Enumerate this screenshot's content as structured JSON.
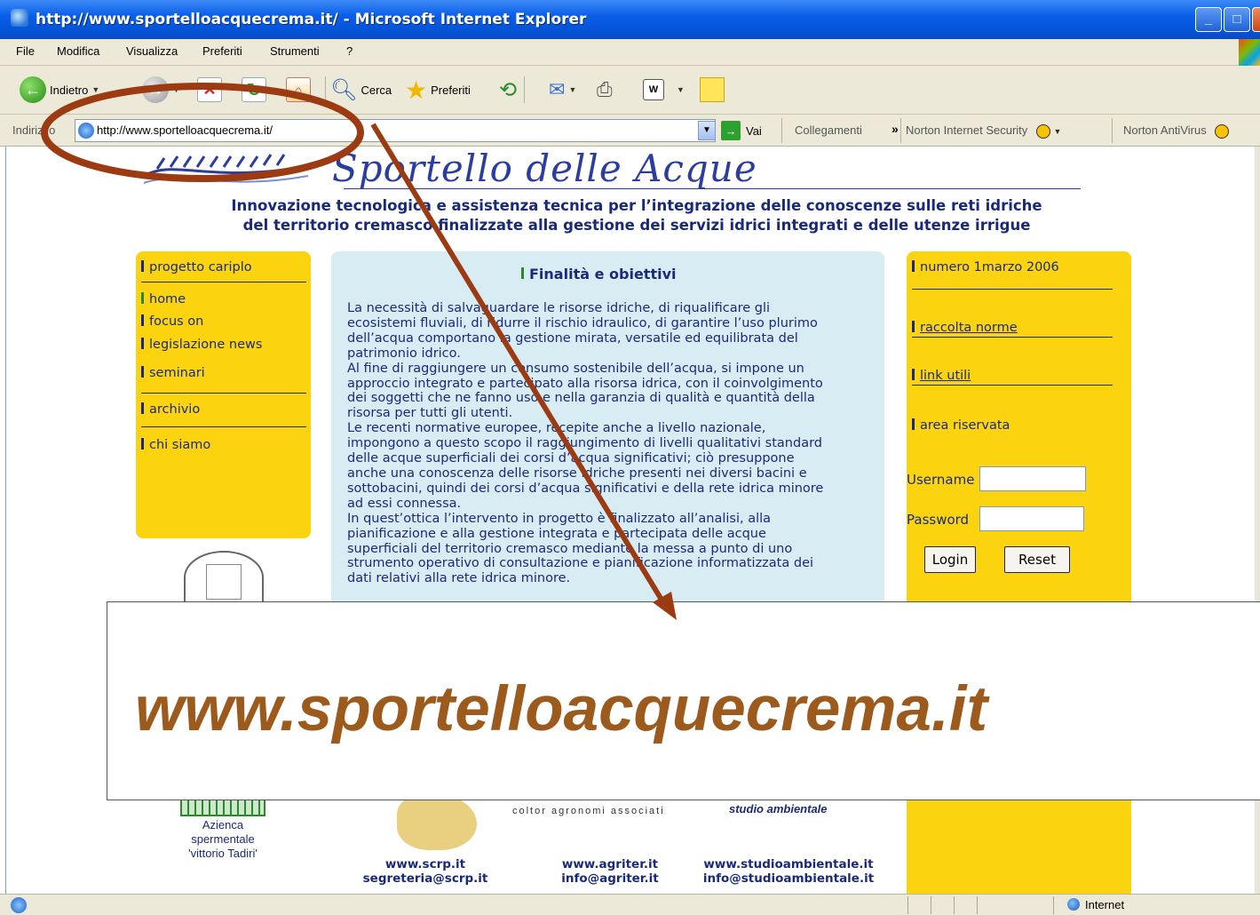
{
  "window": {
    "title": "http://www.sportelloacquecrema.it/ - Microsoft Internet Explorer",
    "minimize": "_",
    "maximize": "□",
    "close": "X"
  },
  "menu": [
    "File",
    "Modifica",
    "Visualizza",
    "Preferiti",
    "Strumenti",
    "?"
  ],
  "toolbar": {
    "back": "Indietro",
    "search": "Cerca",
    "favorites": "Preferiti"
  },
  "addressbar": {
    "label": "Indirizzo",
    "url": "http://www.sportelloacquecrema.it/",
    "go": "Vai",
    "links": "Collegamenti",
    "norton_internet_security": "Norton Internet Security",
    "norton_antivirus": "Norton AntiVirus"
  },
  "page": {
    "site_title": "Sportello delle Acque",
    "subtitle_line1": "Innovazione tecnologica e assistenza tecnica per l’integrazione delle conoscenze sulle reti idriche",
    "subtitle_line2": "del territorio cremasco finalizzate alla gestione dei servizi idrici integrati e delle utenze irrigue",
    "left_nav": {
      "project": "progetto cariplo",
      "home": "home",
      "focus": "focus on",
      "legislation": "legislazione news",
      "seminars": "seminari",
      "archive": "archivio",
      "about": "chi siamo"
    },
    "center": {
      "title": "Finalità e obiettivi",
      "body": "La necessità di salvaguardare le risorse idriche, di riqualificare gli\necosistemi fluviali, di ridurre il rischio idraulico, di garantire l’uso plurimo\ndell’acqua comportano la gestione mirata, versatile ed equilibrata del\npatrimonio idrico.\nAl fine di raggiungere un consumo sostenibile dell’acqua, si impone un\napproccio integrato e partecipato alla risorsa idrica, con il coinvolgimento\ndei soggetti che ne fanno uso e nella garanzia di qualità e quantità della\nrisorsa per tutti gli utenti.\nLe recenti normative europee, recepite anche a livello nazionale,\nimpongono a questo scopo il raggiungimento di livelli qualitativi standard\ndelle acque superficiali dei corsi d’acqua significativi; ciò presuppone\nanche una conoscenza delle risorse idriche presenti nei diversi bacini e\nsottobacini, quindi dei corsi d’acqua significativi e della rete idrica minore\nad essi connessa.\nIn quest’ottica l’intervento in progetto è finalizzato all’analisi, alla\npianificazione e alla gestione integrata e partecipata delle acque\nsuperficiali del territorio cremasco mediante la messa a punto di uno\nstrumento operativo di consultazione e pianificazione informatizzata dei\ndati relativi alla rete idrica minore."
    },
    "right_nav": {
      "issue": "numero 1marzo 2006",
      "norms": "raccolta norme",
      "links": "link utili",
      "reserved": "area riservata",
      "username_label": "Username",
      "password_label": "Password",
      "login": "Login",
      "reset": "Reset"
    },
    "footer": {
      "farm_caption": "Azienca\nspermentale\n'vittorio Tadiri'",
      "coltor": "coltor agronomi associati",
      "studio": "studio ambientale",
      "scrp_site": "www.scrp.it",
      "scrp_mail": "segreteria@scrp.it",
      "agriter_site": "www.agriter.it",
      "agriter_mail": "info@agriter.it",
      "studio_site": "www.studioambientale.it",
      "studio_mail": "info@studioambientale.it"
    }
  },
  "overlay": {
    "text": "www.sportelloacquecrema.it"
  },
  "status": {
    "zone": "Internet"
  },
  "colors": {
    "accent_yellow": "#fbd40f",
    "center_panel": "#d8ecf4",
    "annotation": "#9c3a12",
    "overlay_text": "#9c5a1c"
  }
}
